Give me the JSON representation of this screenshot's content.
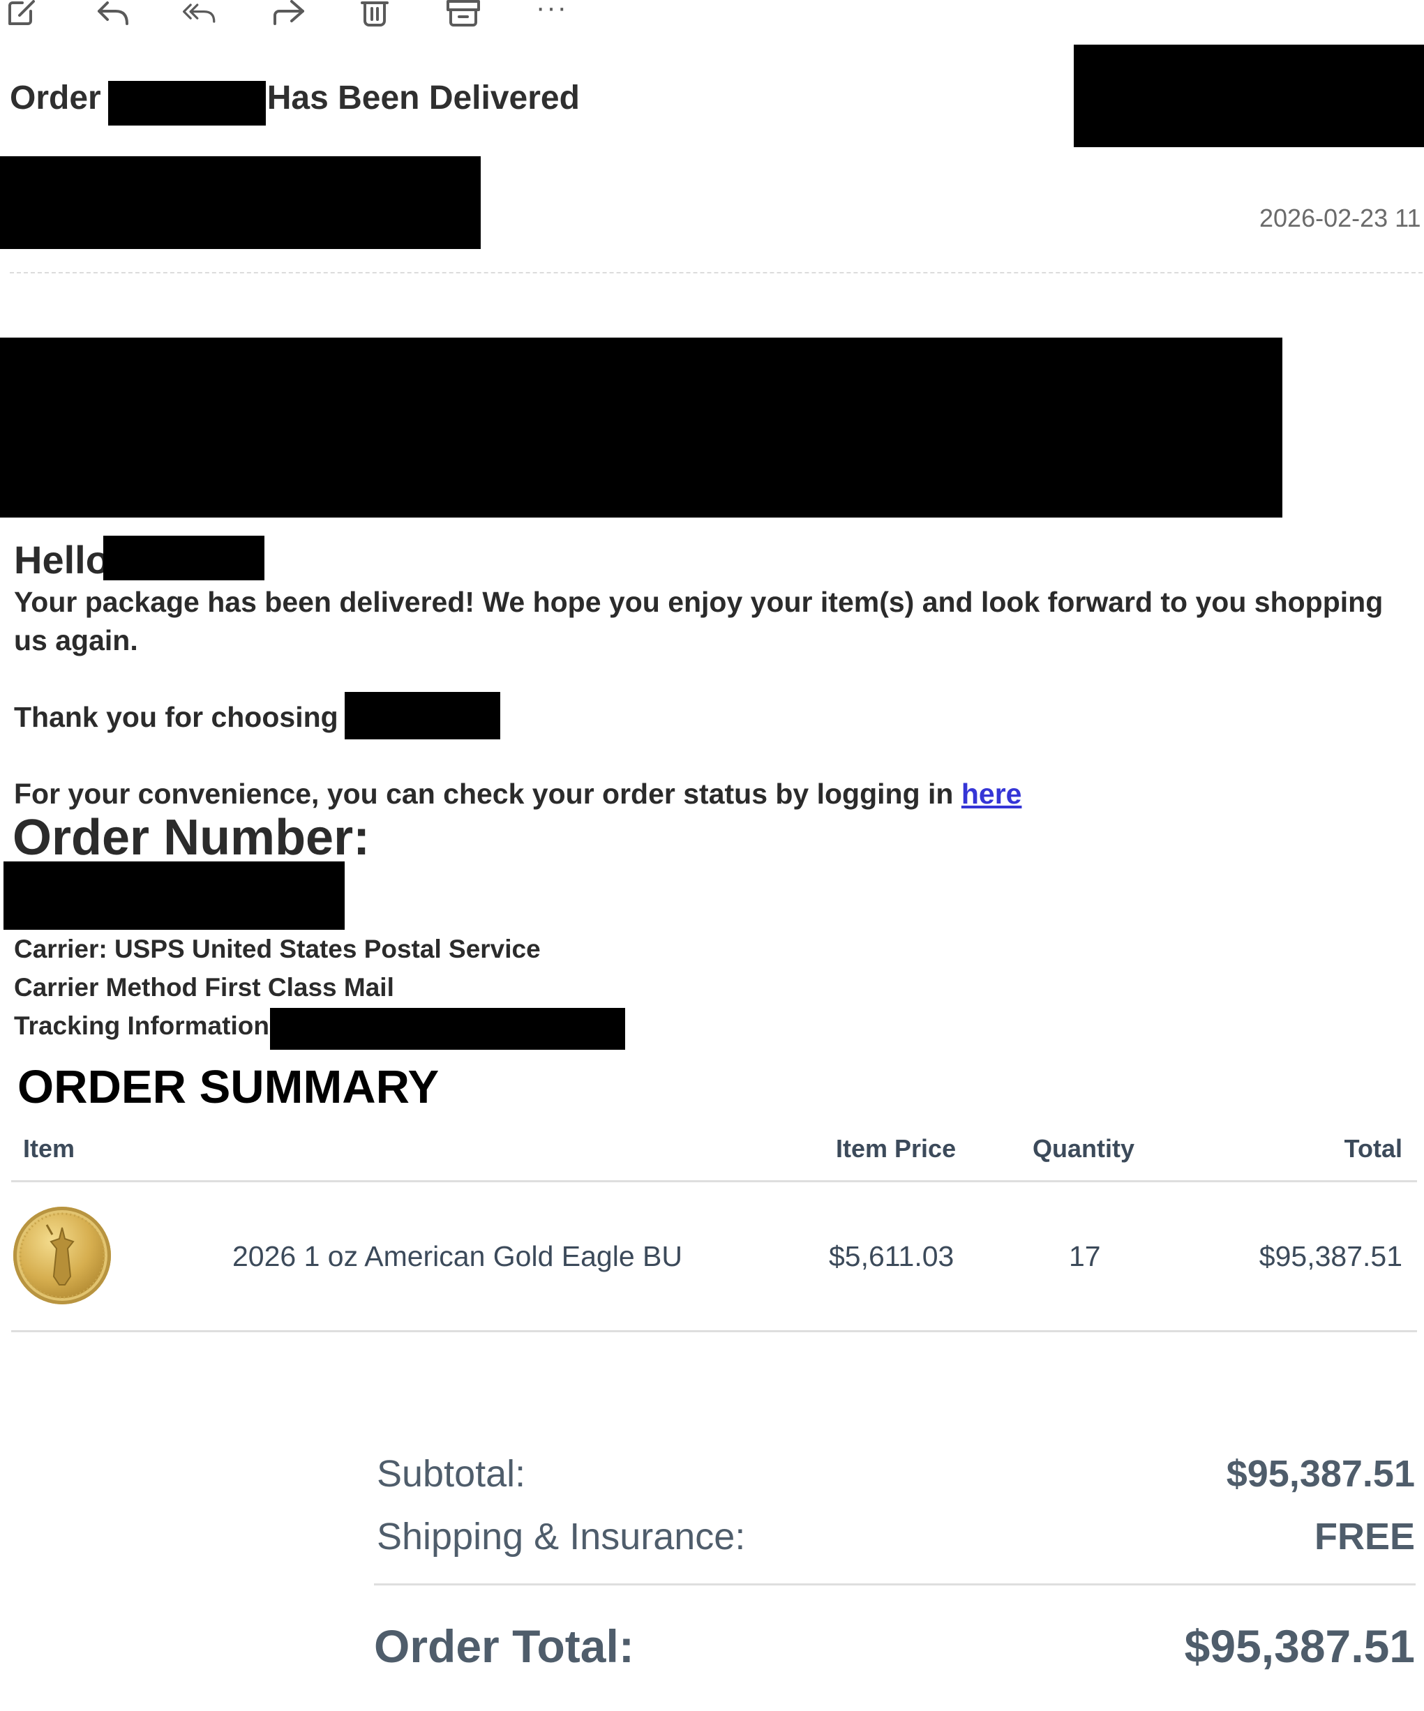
{
  "toolbar": {
    "icons": [
      "compose-icon",
      "reply-icon",
      "reply-all-icon",
      "forward-icon",
      "delete-icon",
      "archive-icon",
      "more-icon"
    ],
    "more_label": "···"
  },
  "email": {
    "subject_prefix": "Order",
    "subject_suffix": "Has Been Delivered",
    "timestamp": "2026-02-23 11"
  },
  "message": {
    "greeting": "Hello",
    "delivered_line_1": "Your package has been delivered! We hope you enjoy your item(s) and look forward to you shopping",
    "delivered_line_2": "us again.",
    "thank_you": "Thank you for choosing",
    "convenience_text": "For your convenience, you can check your order status by logging in ",
    "link_text": "here",
    "order_number_label": "Order Number:",
    "carrier": "Carrier: USPS  United States Postal Service",
    "carrier_method": "Carrier Method First Class Mail",
    "tracking_label": "Tracking Information:"
  },
  "summary": {
    "title": "ORDER SUMMARY",
    "headers": {
      "item": "Item",
      "item_price": "Item Price",
      "quantity": "Quantity",
      "total": "Total"
    },
    "rows": [
      {
        "name": "2026 1 oz American Gold Eagle BU",
        "price": "$5,611.03",
        "quantity": "17",
        "total": "$95,387.51"
      }
    ],
    "subtotal_label": "Subtotal:",
    "subtotal_value": "$95,387.51",
    "shipping_label": "Shipping & Insurance:",
    "shipping_value": "FREE",
    "order_total_label": "Order Total:",
    "order_total_value": "$95,387.51"
  }
}
